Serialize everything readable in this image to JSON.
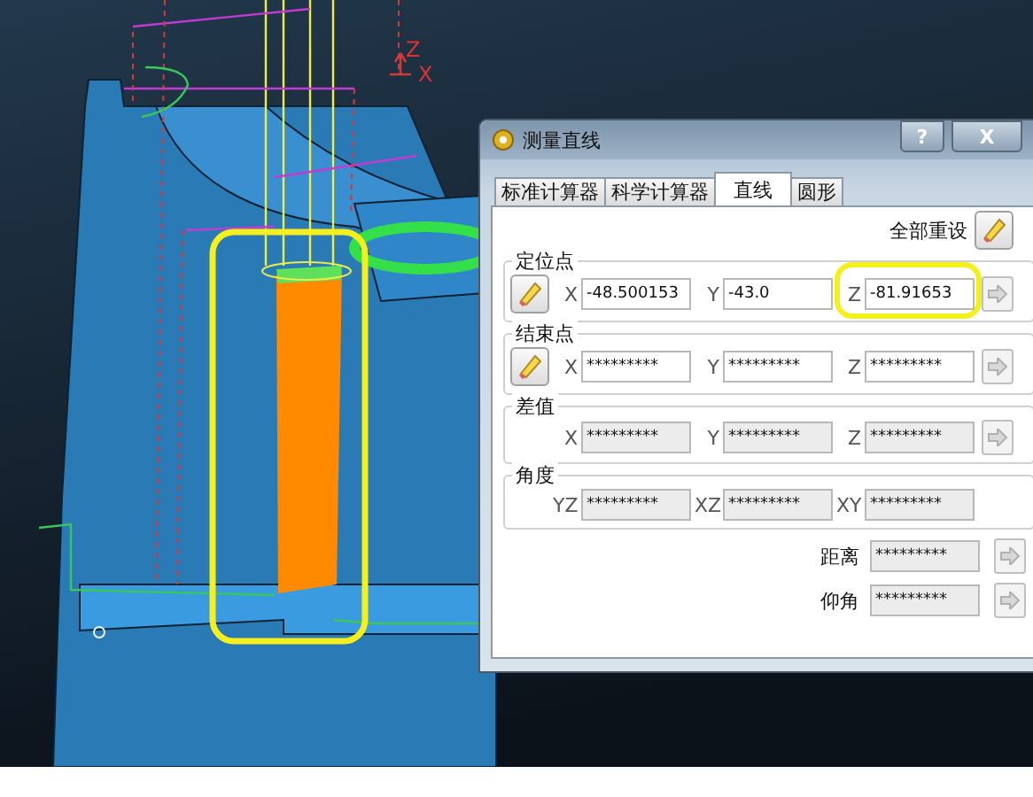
{
  "viewport": {
    "axis_labels": [
      "Z",
      "X"
    ]
  },
  "dialog": {
    "title": "测量直线",
    "help_button": "?",
    "close_button": "X",
    "tabs": [
      {
        "label": "标准计算器",
        "selected": false
      },
      {
        "label": "科学计算器",
        "selected": false
      },
      {
        "label": "直线",
        "selected": true
      },
      {
        "label": "圆形",
        "selected": false
      }
    ],
    "reset_all": "全部重设",
    "groups": [
      {
        "title": "定位点",
        "eraser": true,
        "arrow": true,
        "fields": [
          {
            "label": "X",
            "value": "-48.500153",
            "editable": true,
            "highlighted": false
          },
          {
            "label": "Y",
            "value": "-43.0",
            "editable": true,
            "highlighted": false
          },
          {
            "label": "Z",
            "value": "-81.91653",
            "editable": true,
            "highlighted": true
          }
        ]
      },
      {
        "title": "结束点",
        "eraser": true,
        "arrow": true,
        "fields": [
          {
            "label": "X",
            "value": "*********",
            "editable": true,
            "highlighted": false
          },
          {
            "label": "Y",
            "value": "*********",
            "editable": true,
            "highlighted": false
          },
          {
            "label": "Z",
            "value": "*********",
            "editable": true,
            "highlighted": false
          }
        ]
      },
      {
        "title": "差值",
        "eraser": false,
        "arrow": true,
        "fields": [
          {
            "label": "X",
            "value": "*********",
            "editable": false,
            "highlighted": false
          },
          {
            "label": "Y",
            "value": "*********",
            "editable": false,
            "highlighted": false
          },
          {
            "label": "Z",
            "value": "*********",
            "editable": false,
            "highlighted": false
          }
        ]
      },
      {
        "title": "角度",
        "eraser": false,
        "arrow": false,
        "fields": [
          {
            "label": "YZ",
            "value": "*********",
            "editable": false,
            "highlighted": false
          },
          {
            "label": "XZ",
            "value": "*********",
            "editable": false,
            "highlighted": false
          },
          {
            "label": "XY",
            "value": "*********",
            "editable": false,
            "highlighted": false
          }
        ]
      }
    ],
    "results": [
      {
        "label": "距离",
        "value": "*********"
      },
      {
        "label": "仰角",
        "value": "*********"
      }
    ]
  }
}
